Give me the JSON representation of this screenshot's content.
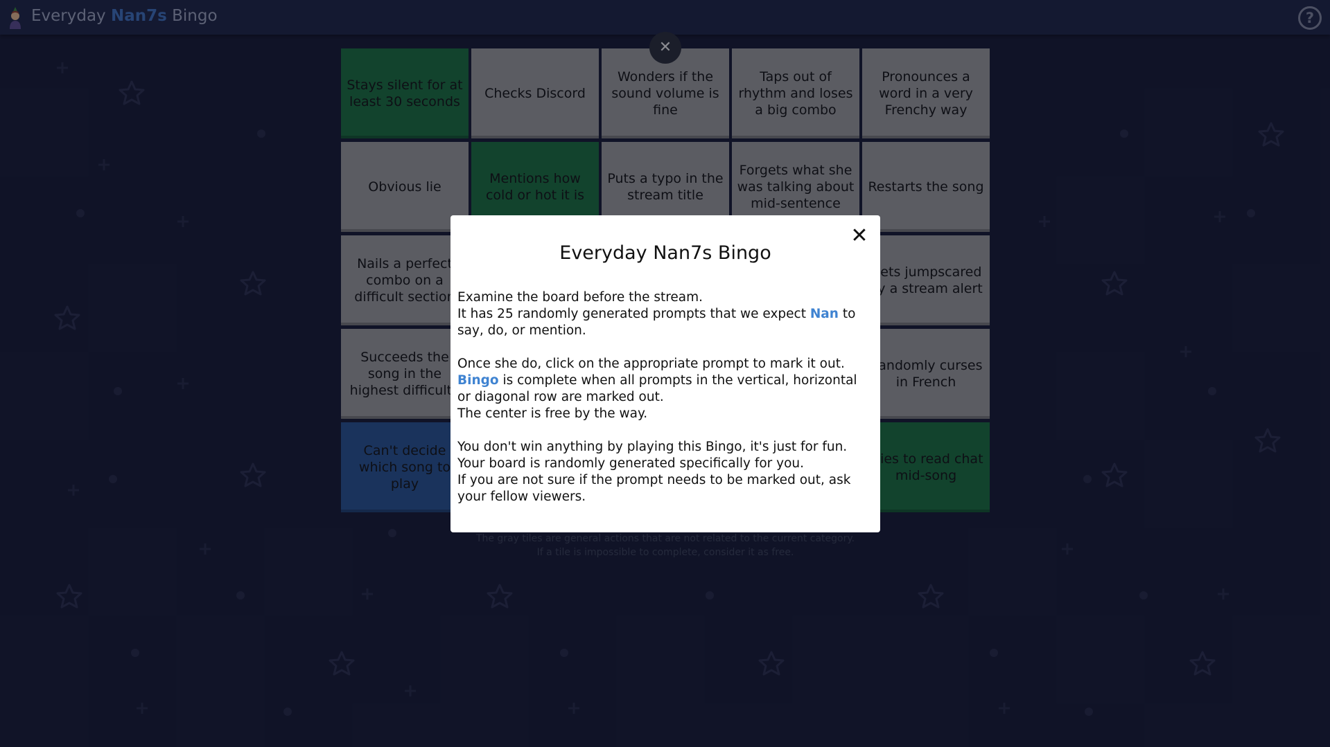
{
  "header": {
    "title_prefix": "Everyday",
    "title_accent": "Nan7s",
    "title_suffix": "Bingo",
    "help_label": "?"
  },
  "board": {
    "close_label": "✕",
    "tiles": [
      {
        "label": "Stays silent for at least 30 seconds",
        "color": "green"
      },
      {
        "label": "Checks Discord",
        "color": "gray"
      },
      {
        "label": "Wonders if the sound volume is fine",
        "color": "gray"
      },
      {
        "label": "Taps out of rhythm and loses a big combo",
        "color": "gray"
      },
      {
        "label": "Pronounces a word in a very Frenchy way",
        "color": "gray"
      },
      {
        "label": "Obvious lie",
        "color": "gray"
      },
      {
        "label": "Mentions how cold or hot it is",
        "color": "green"
      },
      {
        "label": "Puts a typo in the stream title",
        "color": "gray"
      },
      {
        "label": "Forgets what she was talking about mid-sentence",
        "color": "gray"
      },
      {
        "label": "Restarts the song",
        "color": "gray"
      },
      {
        "label": "Nails a perfect combo on a difficult section",
        "color": "gray"
      },
      {
        "label": "",
        "color": "gray"
      },
      {
        "label": "",
        "color": "gray"
      },
      {
        "label": "",
        "color": "gray"
      },
      {
        "label": "Gets jumpscared by a stream alert",
        "color": "gray"
      },
      {
        "label": "Succeeds the song in the highest difficulty",
        "color": "gray"
      },
      {
        "label": "",
        "color": "gray"
      },
      {
        "label": "",
        "color": "gray"
      },
      {
        "label": "",
        "color": "gray"
      },
      {
        "label": "Randomly curses in French",
        "color": "gray"
      },
      {
        "label": "Can't decide which song to play",
        "color": "blue"
      },
      {
        "label": "",
        "color": "gray"
      },
      {
        "label": "",
        "color": "gray"
      },
      {
        "label": "",
        "color": "gray"
      },
      {
        "label": "Tries to read chat mid-song",
        "color": "green"
      }
    ],
    "footnote_line1": "The gray tiles are general actions that are not related to the current category.",
    "footnote_line2": "If a tile is impossible to complete, consider it as free."
  },
  "modal": {
    "title": "Everyday Nan7s Bingo",
    "close_label": "✕",
    "p1_line1": "Examine the board before the stream.",
    "p1_line2_a": "It has 25 randomly generated prompts that we expect ",
    "p1_line2_name": "Nan",
    "p1_line2_b": " to say, do, or mention.",
    "p2_line1": "Once she do, click on the appropriate prompt to mark it out.",
    "p2_bingo": "Bingo",
    "p2_line2": " is complete when all prompts in the vertical, horizontal or diagonal row are marked out.",
    "p2_line3": "The center is free by the way.",
    "p3_line1": "You don't win anything by playing this Bingo, it's just for fun.",
    "p3_line2": "Your board is randomly generated specifically for you.",
    "p3_line3": "If you are not sure if the prompt needs to be marked out, ask your fellow viewers."
  },
  "colors": {
    "background": "#181b33",
    "header": "#1e2544",
    "accent": "#3f83d1",
    "tile_gray": "#989898",
    "tile_green": "#1a6d3d",
    "tile_blue": "#28528e"
  }
}
